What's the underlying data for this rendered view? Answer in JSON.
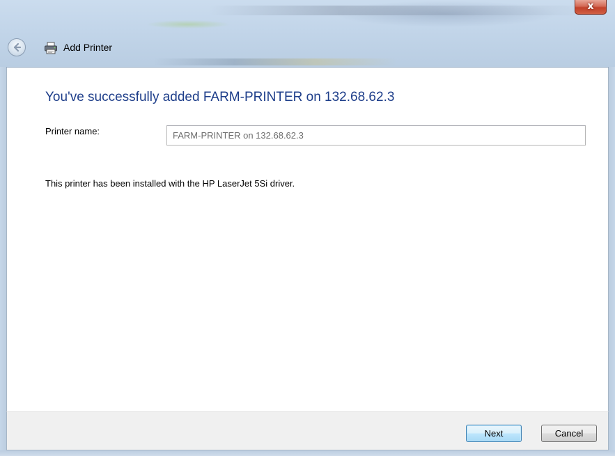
{
  "window": {
    "title": "Add Printer",
    "close_symbol": "x"
  },
  "icons": {
    "back": "back-arrow-icon",
    "printer": "printer-icon",
    "close": "close-icon"
  },
  "content": {
    "heading": "You've successfully added FARM-PRINTER on 132.68.62.3",
    "printer_name_label": "Printer name:",
    "printer_name_value": "FARM-PRINTER on 132.68.62.3",
    "driver_info": "This printer has been installed with the HP LaserJet 5Si driver."
  },
  "footer": {
    "next_label": "Next",
    "cancel_label": "Cancel"
  },
  "colors": {
    "heading": "#1e3e8a",
    "close_button": "#c2412a",
    "default_button_border": "#3c7fb1"
  }
}
